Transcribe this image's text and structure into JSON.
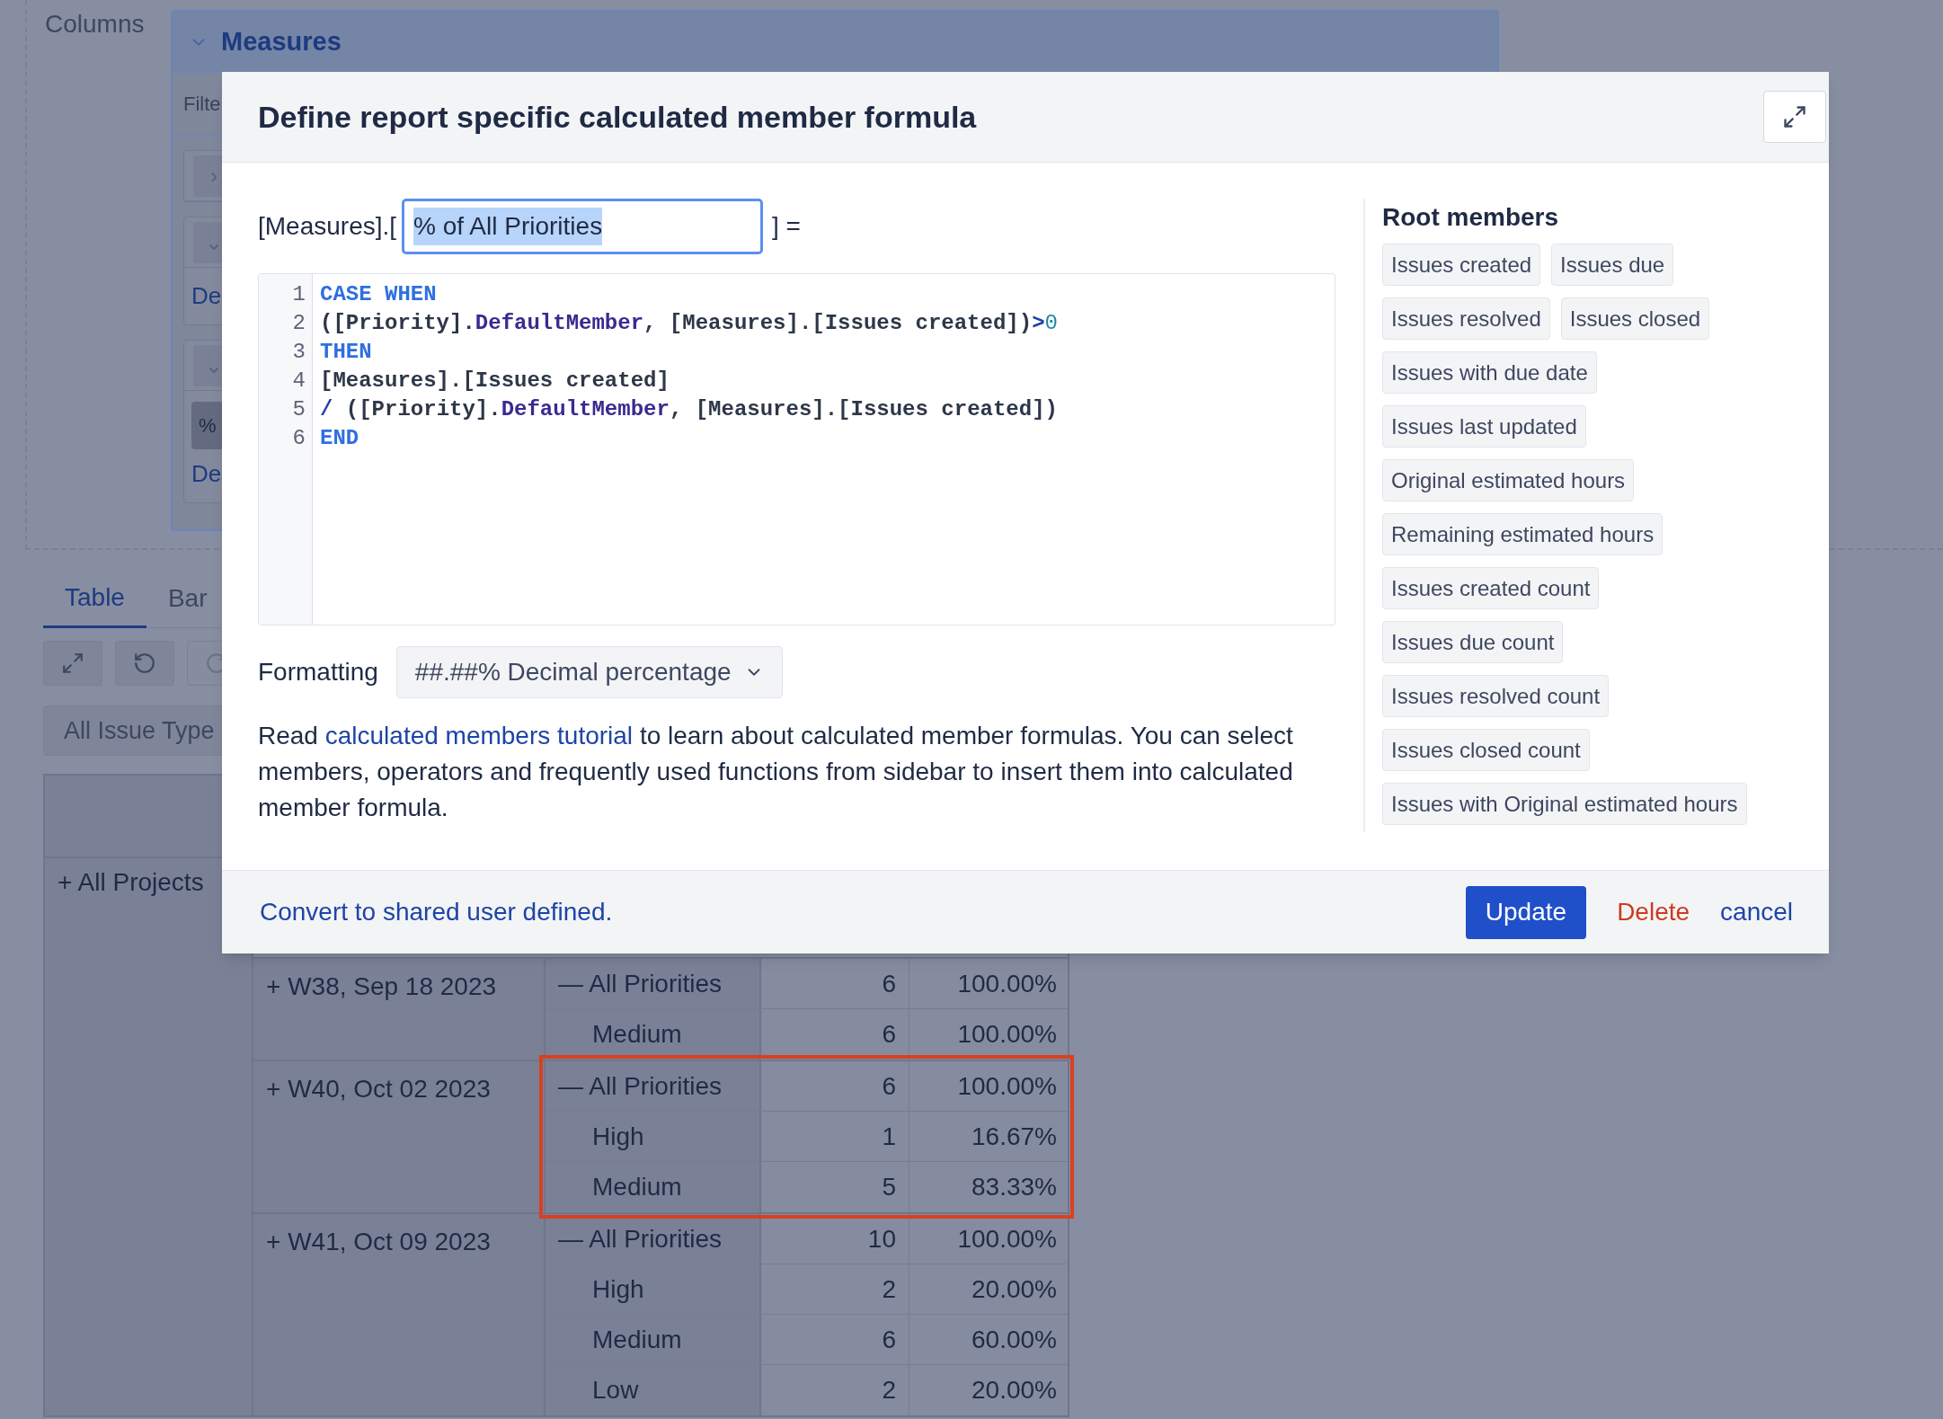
{
  "background": {
    "section_label": "Columns",
    "measures_panel": {
      "title": "Measures",
      "filter_field": {
        "placeholder": "Filte"
      },
      "items": [
        {
          "kind": "collapsed",
          "toggle": "›"
        },
        {
          "kind": "expanded",
          "toggle": "⌄",
          "link": "De"
        },
        {
          "kind": "expanded",
          "toggle": "⌄",
          "chip": "%",
          "link": "De"
        }
      ]
    },
    "tabs": [
      {
        "label": "Table",
        "selected": true
      },
      {
        "label": "Bar",
        "selected": false
      }
    ],
    "toolbar": [
      {
        "kind": "expand",
        "disabled": false
      },
      {
        "kind": "undo",
        "disabled": false
      },
      {
        "kind": "redo",
        "disabled": true
      }
    ],
    "filter_dropdown": {
      "value": "All Issue Type"
    },
    "table": {
      "project": {
        "toggle": "+",
        "label": "All Projects"
      },
      "weeks": [
        {
          "toggle": "+",
          "label": "W38, Sep 18 2023",
          "highlighted": false,
          "priorities": [
            {
              "toggle": "—",
              "name": "All Priorities",
              "count": "6",
              "percent": "100.00%"
            },
            {
              "name": "Medium",
              "count": "6",
              "percent": "100.00%"
            }
          ]
        },
        {
          "toggle": "+",
          "label": "W40, Oct 02 2023",
          "highlighted": true,
          "priorities": [
            {
              "toggle": "—",
              "name": "All Priorities",
              "count": "6",
              "percent": "100.00%"
            },
            {
              "name": "High",
              "count": "1",
              "percent": "16.67%"
            },
            {
              "name": "Medium",
              "count": "5",
              "percent": "83.33%"
            }
          ]
        },
        {
          "toggle": "+",
          "label": "W41, Oct 09 2023",
          "highlighted": false,
          "priorities": [
            {
              "toggle": "—",
              "name": "All Priorities",
              "count": "10",
              "percent": "100.00%"
            },
            {
              "name": "High",
              "count": "2",
              "percent": "20.00%"
            },
            {
              "name": "Medium",
              "count": "6",
              "percent": "60.00%"
            },
            {
              "name": "Low",
              "count": "2",
              "percent": "20.00%"
            }
          ]
        }
      ]
    }
  },
  "dialog": {
    "title": "Define report specific calculated member formula",
    "name_prefix": "[Measures].[",
    "name_field": {
      "value": "% of All Priorities",
      "text_selected": true
    },
    "name_suffix": "] =",
    "code_lines": [
      {
        "number": "1",
        "tokens": [
          {
            "kind": "keyword",
            "text": "CASE WHEN"
          }
        ]
      },
      {
        "number": "2",
        "tokens": [
          {
            "kind": "plain",
            "text": "([Priority]."
          },
          {
            "kind": "function",
            "text": "DefaultMember"
          },
          {
            "kind": "plain",
            "text": ", [Measures].[Issues created])"
          },
          {
            "kind": "operator",
            "text": ">"
          },
          {
            "kind": "number",
            "text": "0"
          }
        ]
      },
      {
        "number": "3",
        "tokens": [
          {
            "kind": "keyword",
            "text": "THEN"
          }
        ]
      },
      {
        "number": "4",
        "tokens": [
          {
            "kind": "plain",
            "text": "[Measures].[Issues created]"
          }
        ]
      },
      {
        "number": "5",
        "tokens": [
          {
            "kind": "operator",
            "text": "/"
          },
          {
            "kind": "plain",
            "text": " ([Priority]."
          },
          {
            "kind": "function",
            "text": "DefaultMember"
          },
          {
            "kind": "plain",
            "text": ", [Measures].[Issues created])"
          }
        ]
      },
      {
        "number": "6",
        "tokens": [
          {
            "kind": "keyword",
            "text": "END"
          }
        ]
      }
    ],
    "formatting": {
      "label": "Formatting",
      "value": "##.##% Decimal percentage"
    },
    "help_text": {
      "before": "Read",
      "link": "calculated members tutorial",
      "after": "to learn about calculated member formulas. You can select members, operators and frequently used functions from sidebar to insert them into calculated member formula."
    },
    "root_members": {
      "title": "Root members",
      "items": [
        "Issues created",
        "Issues due",
        "Issues resolved",
        "Issues closed",
        "Issues with due date",
        "Issues last updated",
        "Original estimated hours",
        "Remaining estimated hours",
        "Issues created count",
        "Issues due count",
        "Issues resolved count",
        "Issues closed count",
        "Issues with Original estimated hours"
      ]
    },
    "footer": {
      "convert_link": "Convert to shared user defined.",
      "buttons": [
        {
          "kind": "primary",
          "label": "Update"
        },
        {
          "kind": "danger",
          "label": "Delete"
        },
        {
          "kind": "link",
          "label": "cancel"
        }
      ]
    }
  }
}
